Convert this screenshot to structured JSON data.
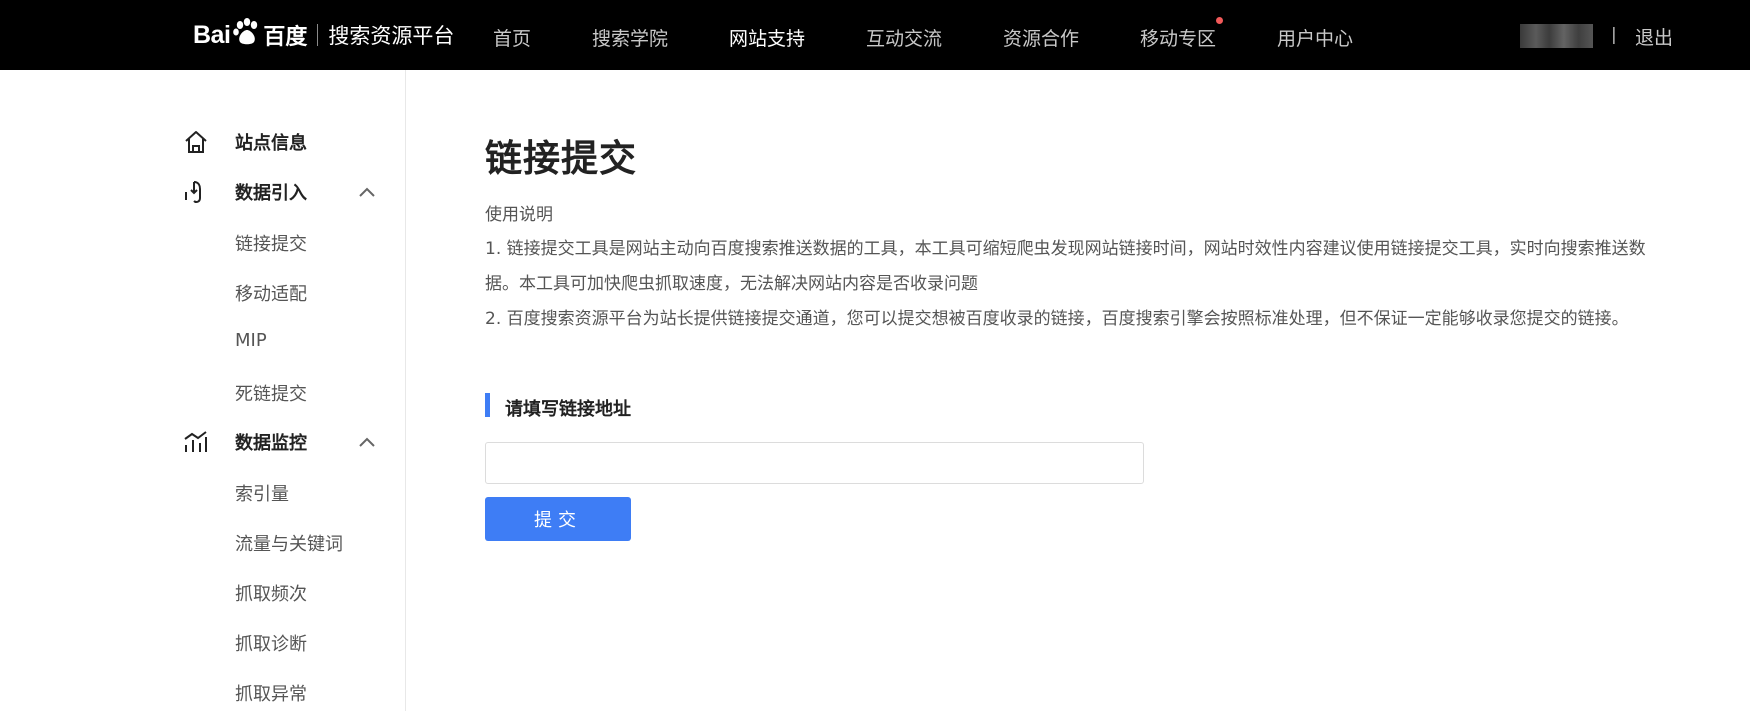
{
  "header": {
    "logo": {
      "bai": "Bai",
      "du": "百度",
      "platform": "搜索资源平台"
    },
    "nav": [
      {
        "label": "首页",
        "active": false
      },
      {
        "label": "搜索学院",
        "active": false
      },
      {
        "label": "网站支持",
        "active": true
      },
      {
        "label": "互动交流",
        "active": false
      },
      {
        "label": "资源合作",
        "active": false
      },
      {
        "label": "移动专区",
        "active": false,
        "badge_dot": true
      },
      {
        "label": "用户中心",
        "active": false
      }
    ],
    "user_divider": "|",
    "logout": "退出"
  },
  "sidebar": {
    "groups": [
      {
        "label": "站点信息",
        "icon": "home-icon",
        "expandable": false,
        "items": []
      },
      {
        "label": "数据引入",
        "icon": "data-import-icon",
        "expandable": true,
        "expanded": true,
        "items": [
          "链接提交",
          "移动适配",
          "MIP",
          "死链提交"
        ]
      },
      {
        "label": "数据监控",
        "icon": "data-monitor-icon",
        "expandable": true,
        "expanded": true,
        "items": [
          "索引量",
          "流量与关键词",
          "抓取频次",
          "抓取诊断",
          "抓取异常"
        ]
      }
    ]
  },
  "main": {
    "title": "链接提交",
    "usage_title": "使用说明",
    "usage_lines": [
      "1. 链接提交工具是网站主动向百度搜索推送数据的工具，本工具可缩短爬虫发现网站链接时间，网站时效性内容建议使用链接提交工具，实时向搜索推送数",
      "据。本工具可加快爬虫抓取速度，无法解决网站内容是否收录问题",
      "2. 百度搜索资源平台为站长提供链接提交通道，您可以提交想被百度收录的链接，百度搜索引擎会按照标准处理，但不保证一定能够收录您提交的链接。"
    ],
    "form_section_title": "请填写链接地址",
    "url_input_value": "",
    "submit_label": "提交"
  },
  "colors": {
    "header_bg": "#000000",
    "accent": "#3e7df5",
    "badge_dot": "#f25a5a"
  }
}
